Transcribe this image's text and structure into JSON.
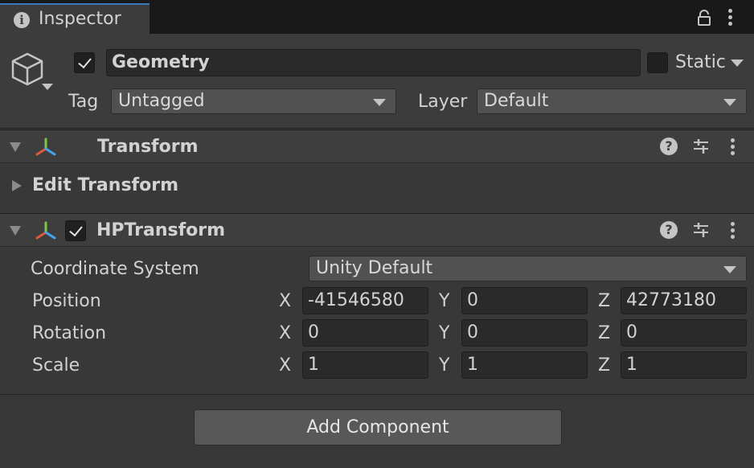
{
  "tab": {
    "title": "Inspector",
    "info_icon": "info-icon"
  },
  "gameobject": {
    "active": true,
    "name": "Geometry",
    "static": false,
    "static_label": "Static",
    "tag_label": "Tag",
    "tag_value": "Untagged",
    "layer_label": "Layer",
    "layer_value": "Default"
  },
  "components": {
    "transform": {
      "title": "Transform",
      "expanded": true
    },
    "edit_transform": {
      "title": "Edit Transform",
      "expanded": false
    },
    "hptransform": {
      "title": "HPTransform",
      "enabled": true,
      "coord_label": "Coordinate System",
      "coord_value": "Unity Default",
      "rows": {
        "position": {
          "label": "Position",
          "x": "-41546580",
          "y": "0",
          "z": "42773180"
        },
        "rotation": {
          "label": "Rotation",
          "x": "0",
          "y": "0",
          "z": "0"
        },
        "scale": {
          "label": "Scale",
          "x": "1",
          "y": "1",
          "z": "1"
        }
      },
      "axis": {
        "x": "X",
        "y": "Y",
        "z": "Z"
      }
    }
  },
  "add_component_label": "Add Component",
  "colors": {
    "accent": "#3a79bb",
    "background": "#383838",
    "field": "#2a2a2a"
  }
}
